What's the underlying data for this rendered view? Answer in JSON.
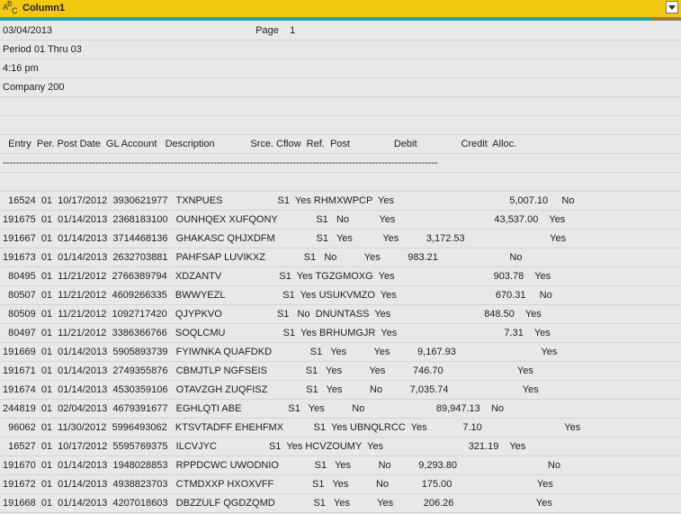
{
  "column": {
    "type_icon": "text-type-icon",
    "type_letters": [
      "A",
      "B",
      "C"
    ],
    "title": "Column1",
    "dropdown_icon": "chevron-down-icon"
  },
  "quality": {
    "valid_fraction": 0.955,
    "colors": {
      "valid": "#21a0a0",
      "other": "#9c7b4a"
    }
  },
  "rows": [
    "03/04/2013                                                                          Page    1",
    "Period 01 Thru 03",
    "4:16 pm",
    "Company 200",
    "",
    "",
    "  Entry  Per. Post Date  GL Account   Description             Srce. Cflow  Ref.  Post                Debit                Credit  Alloc.",
    "------------------------------------------------------------------------------------------------------------------------------------",
    "",
    "  16524  01  10/17/2012  3930621977   TXNPUES                    S1  Yes RHMXWPCP  Yes                                          5,007.10     No",
    "191675  01  01/14/2013  2368183100   OUNHQEX XUFQONY              S1   No           Yes                                    43,537.00    Yes",
    "191667  01  01/14/2013  3714468136   GHAKASC QHJXDFM               S1   Yes           Yes          3,172.53                               Yes",
    "191673  01  01/14/2013  2632703881   PAHFSAP LUVIKXZ              S1   No          Yes          983.21                          No",
    "  80495  01  11/21/2012  2766389794   XDZANTV                     S1  Yes TGZGMOXG  Yes                                    903.78    Yes",
    "  80507  01  11/21/2012  4609266335   BWWYEZL                     S1  Yes USUKVMZO  Yes                                    670.31     No",
    "  80509  01  11/21/2012  1092717420   QJYPKVO                    S1   No  DNUNTASS  Yes                                  848.50    Yes",
    "  80497  01  11/21/2012  3386366766   SOQLCMU                     S1  Yes BRHUMGJR  Yes                                       7.31    Yes",
    "191669  01  01/14/2013  5905893739   FYIWNKA QUAFDKD              S1   Yes          Yes          9,167.93                               Yes",
    "191671  01  01/14/2013  2749355876   CBMJTLP NGFSEIS              S1   Yes          Yes          746.70                           Yes",
    "191674  01  01/14/2013  4530359106   OTAVZGH ZUQFISZ              S1   Yes          No          7,035.74                           Yes",
    "244819  01  02/04/2013  4679391677   EGHLQTI ABE                 S1   Yes          No                          89,947.13    No",
    "  96062  01  11/30/2012  5996493062   KTSVTADFF EHEHFMX           S1  Yes UBNQLRCC  Yes             7.10                              Yes",
    "  16527  01  10/17/2012  5595769375   ILCVJYC                   S1  Yes HCVZOUMY  Yes                               321.19    Yes",
    "191670  01  01/14/2013  1948028853   RPPDCWC UWODNIO             S1   Yes          No          9,293.80                                 No",
    "191672  01  01/14/2013  4938823703   CTMDXXP HXOXVFF              S1   Yes          No            175.00                               Yes",
    "191668  01  01/14/2013  4207018603   DBZZULF QGDZQMD              S1   Yes          Yes           206.26                              Yes"
  ]
}
